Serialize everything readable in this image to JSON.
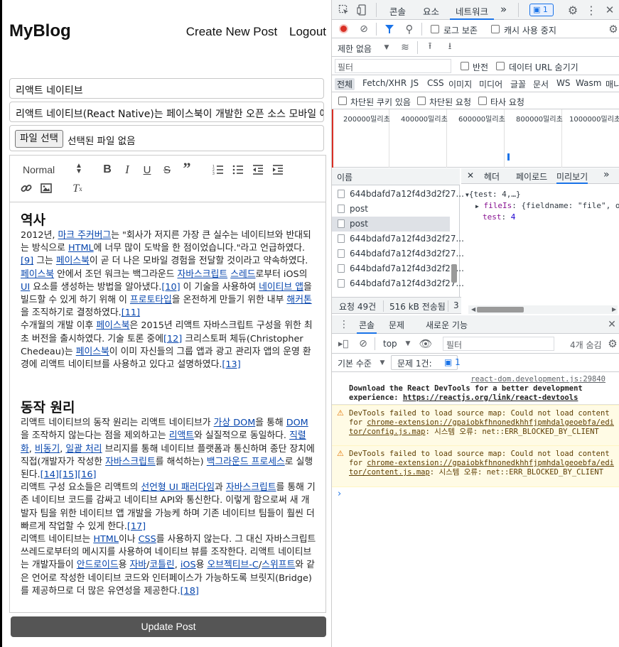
{
  "app": {
    "brand": "MyBlog",
    "nav": {
      "create": "Create New Post",
      "logout": "Logout"
    },
    "form": {
      "title_value": "리액트 네이티브",
      "summary_value": "리액트 네이티브(React Native)는 페이스북이 개발한 오픈 소스 모바일 애플리",
      "file_button": "파일 선택",
      "file_label": "선택된 파일 없음"
    },
    "editor": {
      "heading_select": "Normal",
      "sections": [
        {
          "heading": "역사"
        },
        {
          "heading": "동작 원리"
        }
      ]
    },
    "update_button": "Update Post"
  },
  "devtools": {
    "top_tabs": [
      "콘솔",
      "요소",
      "네트워크",
      "»"
    ],
    "issues_badge": "1",
    "network": {
      "preserve_log": "로그 보존",
      "disable_cache": "캐시 사용 중지",
      "throttle": "제한 없음",
      "filter_placeholder": "필터",
      "invert": "반전",
      "hide_data_urls": "데이터 URL 숨기기",
      "types": [
        "전체",
        "Fetch/XHR",
        "JS",
        "CSS",
        "이미지",
        "미디어",
        "글꼴",
        "문서",
        "WS",
        "Wasm",
        "매니"
      ],
      "blocked_cookies": "차단된 쿠키 있음",
      "blocked_requests": "차단된 요청",
      "third_party": "타사 요청",
      "timeline_ticks": [
        "200000밀리초",
        "400000밀리초",
        "600000밀리초",
        "800000밀리초",
        "1000000밀리초"
      ],
      "name_header": "이름",
      "requests": [
        "644bdafd7a12f4d3d2f27...",
        "post",
        "post",
        "644bdafd7a12f4d3d2f27...",
        "644bdafd7a12f4d3d2f27...",
        "644bdafd7a12f4d3d2f27...",
        "644bdafd7a12f4d3d2f27..."
      ],
      "detail_tabs": [
        "헤더",
        "페이로드",
        "미리보기",
        "»"
      ],
      "preview": {
        "root": "{test: 4,…}",
        "fileIs_key": "fileIs",
        "fileIs_val": "{fieldname: \"file\", o",
        "test_key": "test",
        "test_val": "4"
      },
      "summary": {
        "requests": "요청 49건",
        "transferred": "516 kB 전송됨",
        "extra": "3"
      }
    },
    "drawer": {
      "tabs": [
        "콘솔",
        "문제",
        "새로운 기능"
      ],
      "context": "top",
      "filter_placeholder": "필터",
      "hidden_count": "4개 숨김",
      "level": "기본 수준",
      "issues_label": "문제 1건:",
      "issues_count": "1",
      "messages": [
        {
          "source": "react-dom.development.js:29840",
          "text": "Download the React DevTools for a better development experience: ",
          "link": "https://reactjs.org/link/react-devtools"
        },
        {
          "text1": "DevTools failed to load source map: Could not load content for ",
          "link": "chrome-extension://gpaiobkfhnonedkhhfjpmhdalgeoebfa/editor/config.js.map",
          "text2": ": 시스템 오류: net::ERR_BLOCKED_BY_CLIENT"
        },
        {
          "text1": "DevTools failed to load source map: Could not load content for ",
          "link": "chrome-extension://gpaiobkfhnonedkhhfjpmhdalgeoebfa/editor/content.js.map",
          "text2": ": 시스템 오류: net::ERR_BLOCKED_BY_CLIENT"
        }
      ]
    }
  }
}
